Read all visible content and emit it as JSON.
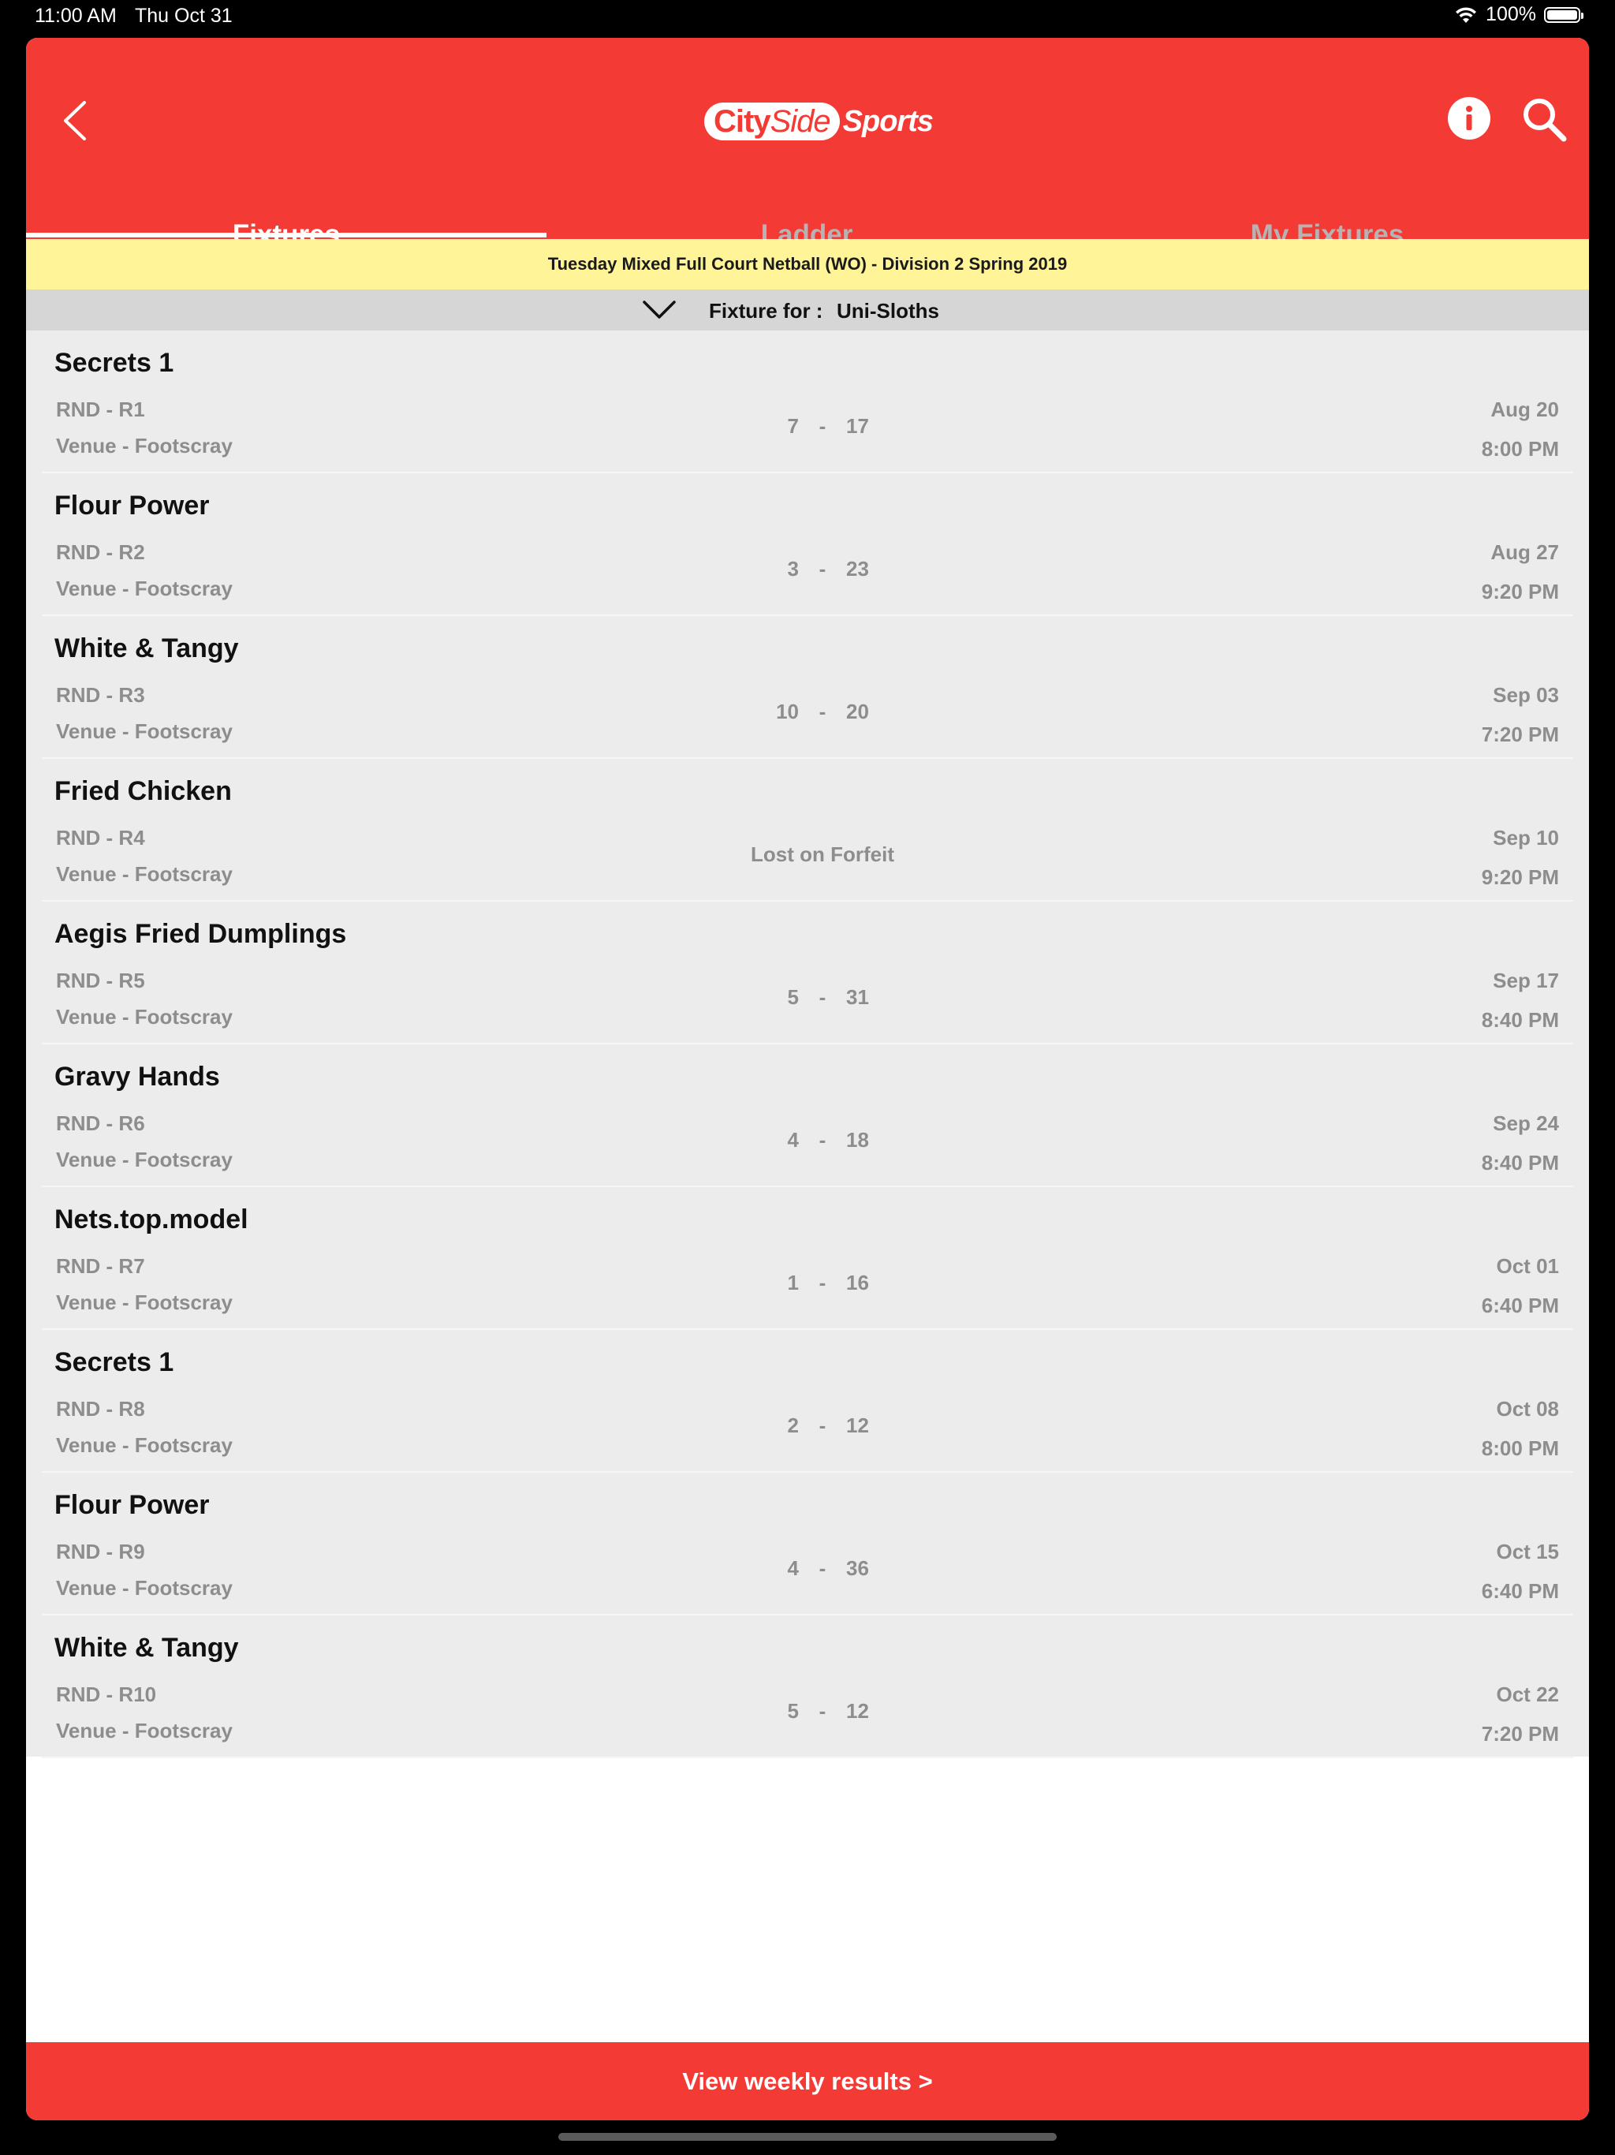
{
  "status_bar": {
    "time": "11:00 AM",
    "date": "Thu Oct 31",
    "battery": "100%"
  },
  "header": {
    "logo": {
      "city": "City",
      "side": "Side",
      "sports": "Sports"
    },
    "tabs": [
      {
        "label": "Fixtures",
        "active": true
      },
      {
        "label": "Ladder",
        "active": false
      },
      {
        "label": "My Fixtures",
        "active": false
      }
    ],
    "accent_color": "#f33a35"
  },
  "division_title": "Tuesday Mixed Full Court Netball (WO) - Division 2 Spring 2019",
  "fixture_for": {
    "label": "Fixture for :",
    "team": "Uni-Sloths"
  },
  "fixtures": [
    {
      "opponent": "Secrets 1",
      "round": "RND - R1",
      "venue": "Venue - Footscray",
      "home": "7",
      "away": "17",
      "date": "Aug 20",
      "time": "8:00 PM"
    },
    {
      "opponent": "Flour Power",
      "round": "RND - R2",
      "venue": "Venue - Footscray",
      "home": "3",
      "away": "23",
      "date": "Aug 27",
      "time": "9:20 PM"
    },
    {
      "opponent": "White & Tangy",
      "round": "RND - R3",
      "venue": "Venue - Footscray",
      "home": "10",
      "away": "20",
      "date": "Sep 03",
      "time": "7:20 PM"
    },
    {
      "opponent": "Fried Chicken",
      "round": "RND - R4",
      "venue": "Venue - Footscray",
      "result_text": "Lost on Forfeit",
      "date": "Sep 10",
      "time": "9:20 PM"
    },
    {
      "opponent": "Aegis Fried Dumplings",
      "round": "RND - R5",
      "venue": "Venue - Footscray",
      "home": "5",
      "away": "31",
      "date": "Sep 17",
      "time": "8:40 PM"
    },
    {
      "opponent": "Gravy Hands",
      "round": "RND - R6",
      "venue": "Venue - Footscray",
      "home": "4",
      "away": "18",
      "date": "Sep 24",
      "time": "8:40 PM"
    },
    {
      "opponent": "Nets.top.model",
      "round": "RND - R7",
      "venue": "Venue - Footscray",
      "home": "1",
      "away": "16",
      "date": "Oct 01",
      "time": "6:40 PM"
    },
    {
      "opponent": "Secrets 1",
      "round": "RND - R8",
      "venue": "Venue - Footscray",
      "home": "2",
      "away": "12",
      "date": "Oct 08",
      "time": "8:00 PM"
    },
    {
      "opponent": "Flour Power",
      "round": "RND - R9",
      "venue": "Venue - Footscray",
      "home": "4",
      "away": "36",
      "date": "Oct 15",
      "time": "6:40 PM"
    },
    {
      "opponent": "White & Tangy",
      "round": "RND - R10",
      "venue": "Venue - Footscray",
      "home": "5",
      "away": "12",
      "date": "Oct 22",
      "time": "7:20 PM"
    }
  ],
  "score_separator": "-",
  "footer": {
    "label": "View weekly results >"
  }
}
